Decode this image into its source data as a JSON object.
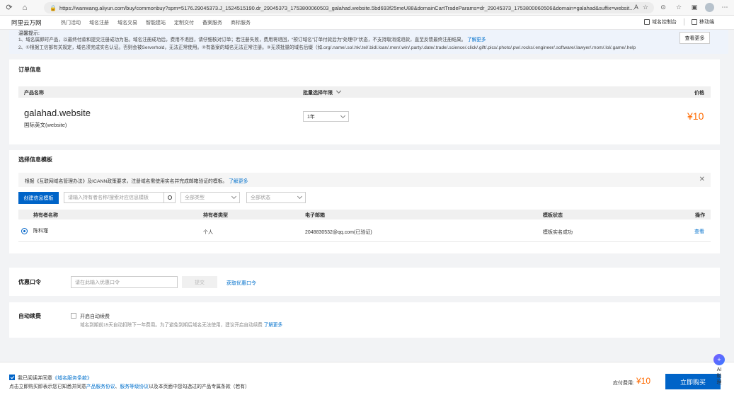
{
  "browser": {
    "url": "https://wanwang.aliyun.com/buy/commonbuy?spm=5176.29045373.J_1524515190.dr_29045373_1753800060503_galahad.website.5bd693f25meU88&domainCartTradeParams=dr_29045373_1753800060506&domain=galahad&suffix=websit..."
  },
  "header": {
    "logo": "阿里云万网",
    "nav": [
      "热门活动",
      "域名注册",
      "域名交易",
      "智能建站",
      "定制交付",
      "备案服务",
      "商标服务"
    ],
    "console": "域名控制台",
    "mobile": "移动端"
  },
  "notice": {
    "title": "温馨提示:",
    "line1": "1、域名属即时产品，以最终付款和提交注册成功为准。域名注册成功后，费用不退回，请仔细核对订单；若注册失败，费用将退回，“预订域名”订单付款后为“处理中”状态，不支持取消或退款，直至反馈最终注册结果。",
    "line1_link": "了解更多",
    "line2": "2、①根据工信部有关规定，域名须完成实名认证。否则会被Serverhold，无法正常使用。②有备案的域名无法正常注册。③无须批量的域名后缀（如.org/.name/.so/.hk/.tel/.bid/.loan/.men/.win/.party/.date/.trade/.science/.click/.gift/.pics/.photo/.pw/.rocks/.engineer/.software/.lawyer/.mom/.lol/.game/.help",
    "see_more": "查看更多"
  },
  "order": {
    "title": "订单信息",
    "col_product": "产品名称",
    "col_years": "批量选择年限",
    "col_price": "价格",
    "domain": "galahad.website",
    "domain_type": "国际英文(website)",
    "years": "1年",
    "price": "¥10"
  },
  "template": {
    "title": "选择信息模板",
    "info": "根据《互联网域名管理办法》及ICANN政策要求，注册域名需使用实名并完成邮箱验证的模板。",
    "info_link": "了解更多",
    "create_btn": "创建信息模板",
    "search_placeholder": "请输入持有者名称/搜索对应信息模板",
    "type_select": "全部类型",
    "status_select": "全部状态",
    "col_holder": "持有者名称",
    "col_type": "持有者类型",
    "col_email": "电子邮箱",
    "col_status": "模板状态",
    "col_action": "操作",
    "row": {
      "holder": "陈科瑾",
      "type": "个人",
      "email": "2048830532@qq.com(已验证)",
      "status": "模板实名成功",
      "action": "查看"
    }
  },
  "coupon": {
    "title": "优惠口令",
    "placeholder": "请在此输入优惠口令",
    "submit": "提交",
    "get_link": "获取优惠口令"
  },
  "renew": {
    "title": "自动续费",
    "checkbox_label": "开启自动续费",
    "desc": "域名到期前15天自动扣除下一年费用。为了避免到期后域名无法使用，建议开启自动续费",
    "link": "了解更多"
  },
  "footer": {
    "agree_text": "我已阅读并同意",
    "agree_link": "《域名服务条款》",
    "terms_prefix": "点击立即购买即表示您已知悉并同意",
    "terms_link1": "产品服务协议",
    "terms_sep": "、",
    "terms_link2": "服务等级协议",
    "terms_suffix": "以及本页面中您勾选过的产品专属条款（若有）",
    "total_label": "应付费用:",
    "total_value": "¥10",
    "buy_btn": "立即购买"
  },
  "ai": {
    "label_ai": "AI",
    "label_1": "助",
    "label_2": "理"
  },
  "colors": {
    "primary": "#0064c8",
    "price": "#ff6a00",
    "link": "#0070cc"
  }
}
